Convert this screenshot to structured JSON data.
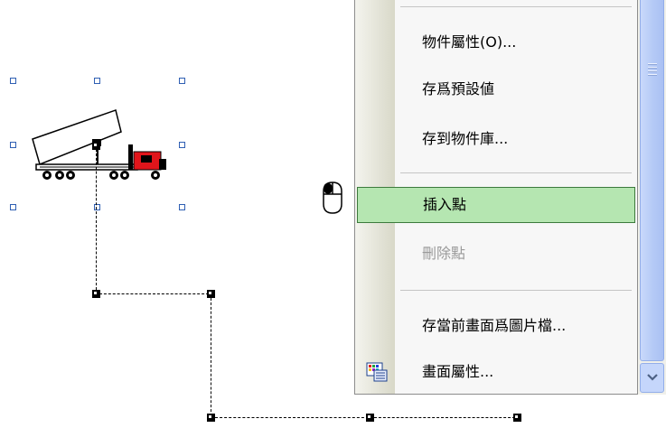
{
  "context_menu": {
    "items": [
      {
        "label": "物件屬性(O)...",
        "state": "normal"
      },
      {
        "label": "存爲預設値",
        "state": "normal"
      },
      {
        "label": "存到物件庫...",
        "state": "normal"
      },
      {
        "label": "插入點",
        "state": "hover"
      },
      {
        "label": "刪除點",
        "state": "disabled"
      },
      {
        "label": "存當前畫面爲圖片檔...",
        "state": "normal"
      },
      {
        "label": "畫面屬性...",
        "state": "normal",
        "icon": "screen-properties-icon"
      }
    ]
  },
  "canvas": {
    "object": "dump-truck-icon",
    "cursor": "mouse-icon"
  },
  "scrollbar": {
    "icon_down": "chevron-down-icon"
  },
  "colors": {
    "hover_bg": "#b5e6b1",
    "scroll_thumb": "#b6cbf6",
    "handle_blue": "#2f5fb3"
  }
}
